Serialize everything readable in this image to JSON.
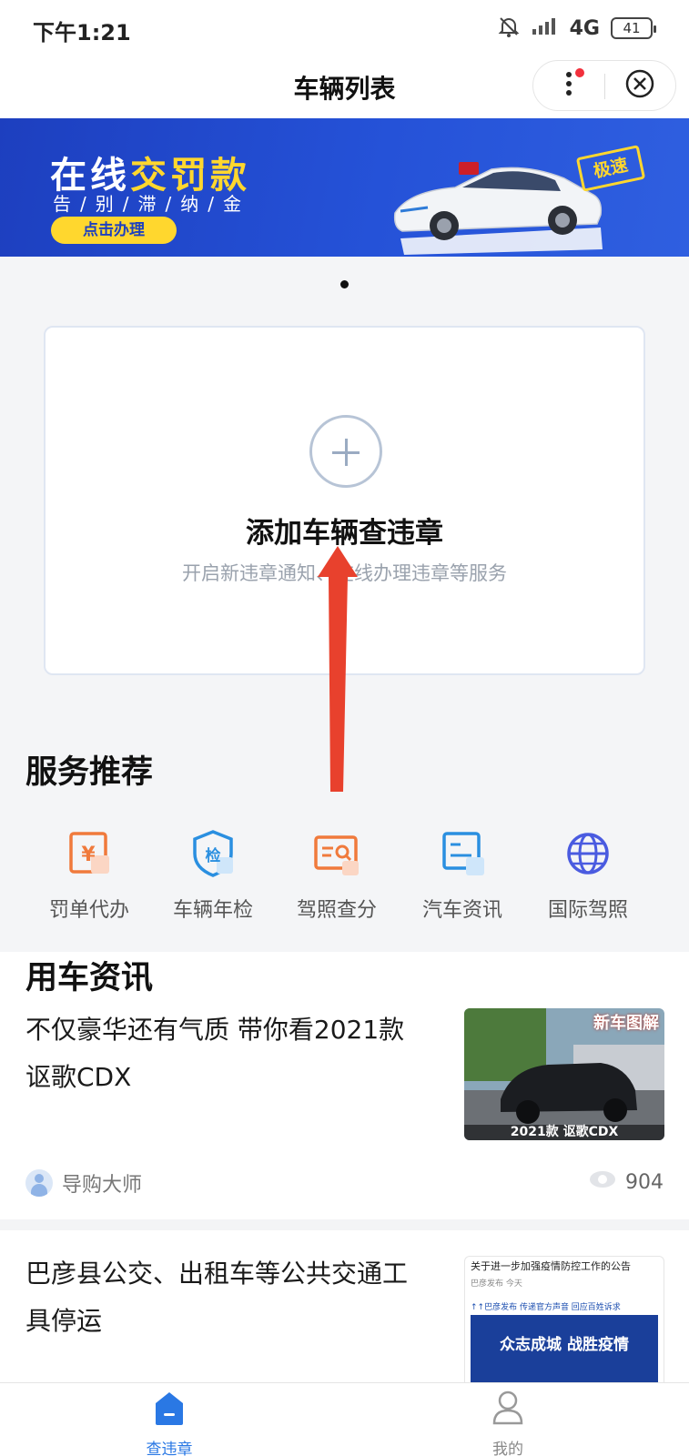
{
  "status_bar": {
    "time": "下午1:21",
    "network": "4G",
    "battery": "41"
  },
  "nav": {
    "title": "车辆列表"
  },
  "banner": {
    "title_prefix": "在线",
    "title_highlight": "交罚款",
    "subtitle": "告/别/滞/纳/金",
    "button_label": "点击办理",
    "tag": "极速"
  },
  "add_vehicle": {
    "title": "添加车辆查违章",
    "subtitle": "开启新违章通知、在线办理违章等服务"
  },
  "services": {
    "title": "服务推荐",
    "items": [
      {
        "label": "罚单代办",
        "icon": "ticket-yuan-icon",
        "color": "#f07a3c"
      },
      {
        "label": "车辆年检",
        "icon": "inspection-shield-icon",
        "color": "#2a8fe0"
      },
      {
        "label": "驾照查分",
        "icon": "license-search-icon",
        "color": "#f07a3c"
      },
      {
        "label": "汽车资讯",
        "icon": "news-card-icon",
        "color": "#2a8fe0"
      },
      {
        "label": "国际驾照",
        "icon": "globe-icon",
        "color": "#4a5be0"
      }
    ]
  },
  "news": {
    "title": "用车资讯",
    "items": [
      {
        "title": "不仅豪华还有气质 带你看2021款讴歌CDX",
        "author": "导购大师",
        "views": "904",
        "thumb_tag": "新车图解",
        "thumb_caption": "2021款 讴歌CDX"
      },
      {
        "title": "巴彦县公交、出租车等公共交通工具停运",
        "thumb_header": "关于进一步加强疫情防控工作的公告",
        "thumb_source": "巴彦发布",
        "thumb_time": "今天",
        "thumb_links": "↑↑巴彦发布  传递官方声音  回应百姓诉求",
        "thumb_slogan": "众志成城 战胜疫情"
      }
    ]
  },
  "tabbar": {
    "items": [
      {
        "label": "查违章",
        "active": true
      },
      {
        "label": "我的",
        "active": false
      }
    ]
  },
  "colors": {
    "accent": "#2a78e4",
    "arrow": "#e8412d",
    "banner_blue": "#1d3fbf",
    "banner_yellow": "#ffd72e"
  }
}
